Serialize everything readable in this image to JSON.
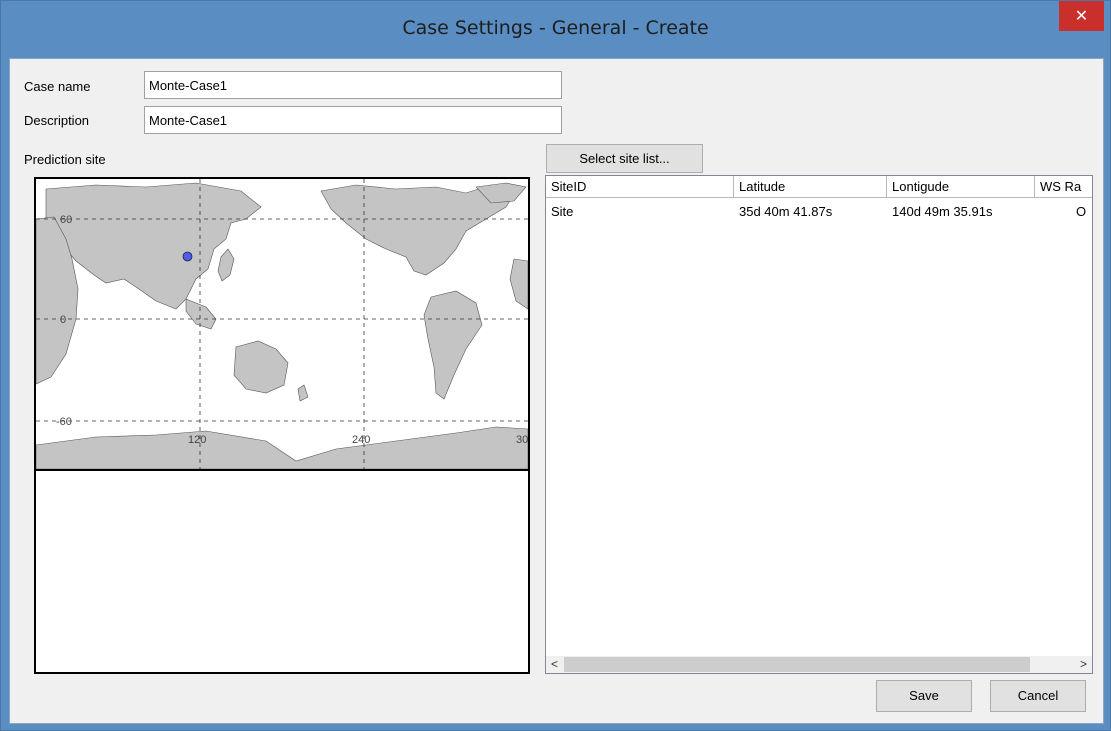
{
  "window": {
    "title": "Case Settings - General - Create",
    "close_glyph": "✕"
  },
  "form": {
    "case_name_label": "Case name",
    "case_name_value": "Monte-Case1",
    "description_label": "Description",
    "description_value": "Monte-Case1",
    "prediction_site_label": "Prediction site"
  },
  "map": {
    "lat_labels": [
      "60",
      "0",
      "-60"
    ],
    "lon_labels": [
      "120",
      "240",
      "30"
    ],
    "site_marker": {
      "lat": 35.69,
      "lon": 140.83,
      "color": "#4d5df2"
    }
  },
  "buttons": {
    "select_site_list": "Select site list...",
    "save": "Save",
    "cancel": "Cancel"
  },
  "site_table": {
    "columns": [
      "SiteID",
      "Latitude",
      "Lontigude",
      "WS Ra"
    ],
    "rows": [
      [
        "Site",
        "35d 40m 41.87s",
        "140d 49m 35.91s",
        "O"
      ]
    ]
  },
  "scrollbar": {
    "left_arrow": "<",
    "right_arrow": ">"
  }
}
